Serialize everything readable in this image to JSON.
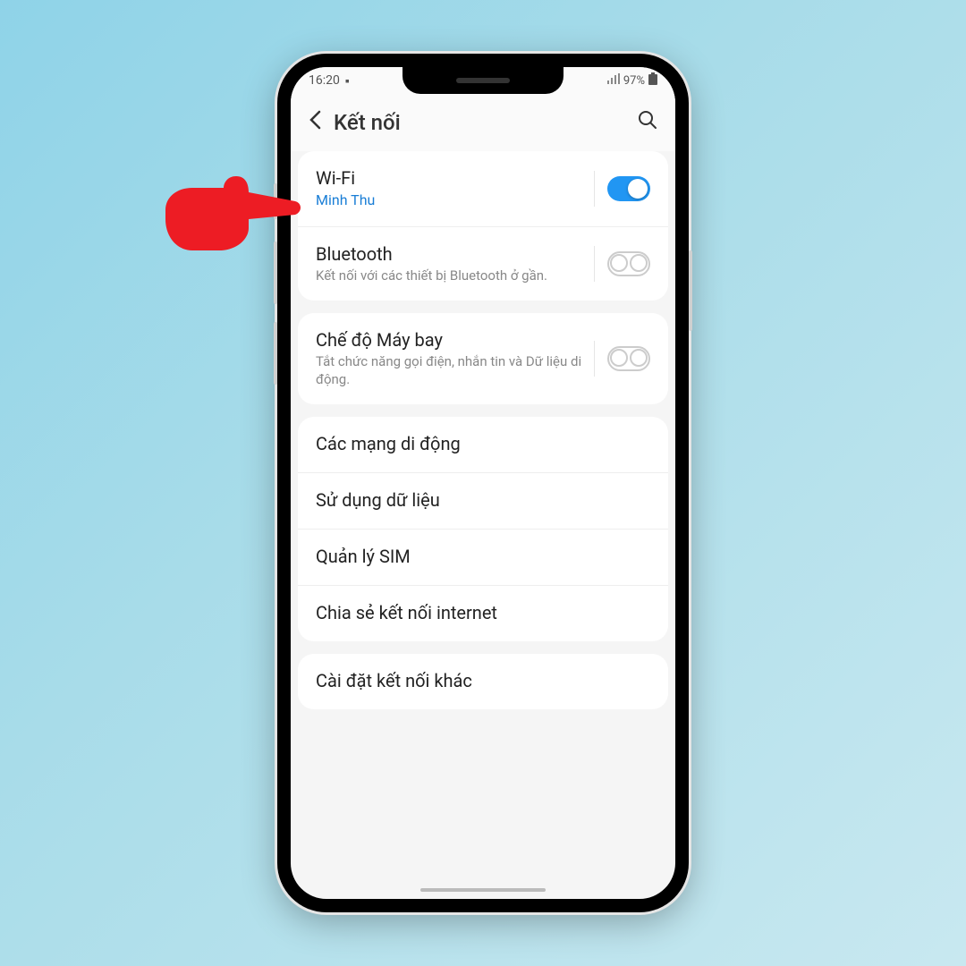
{
  "status": {
    "time": "16:20",
    "battery": "97%"
  },
  "header": {
    "title": "Kết nối"
  },
  "sections": [
    {
      "rows": [
        {
          "title": "Wi-Fi",
          "sub": "Minh Thu",
          "subBlue": true,
          "toggle": "on"
        },
        {
          "title": "Bluetooth",
          "sub": "Kết nối với các thiết bị Bluetooth ở gần.",
          "toggle": "off"
        }
      ]
    },
    {
      "rows": [
        {
          "title": "Chế độ Máy bay",
          "sub": "Tắt chức năng gọi điện, nhắn tin và Dữ liệu di động.",
          "toggle": "off"
        }
      ]
    },
    {
      "rows": [
        {
          "title": "Các mạng di động"
        },
        {
          "title": "Sử dụng dữ liệu"
        },
        {
          "title": "Quản lý SIM"
        },
        {
          "title": "Chia sẻ kết nối internet"
        }
      ]
    },
    {
      "rows": [
        {
          "title": "Cài đặt kết nối khác"
        }
      ]
    }
  ]
}
